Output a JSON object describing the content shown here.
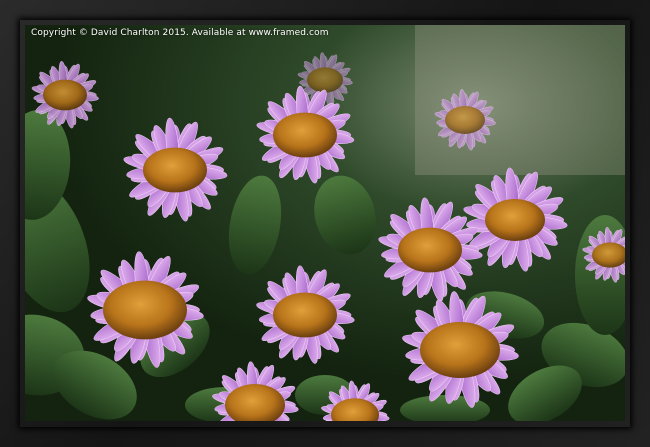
{
  "watermark": {
    "text": "Copyright © David Charlton 2015. Available at www.framed.com"
  },
  "colors": {
    "frame": "#1e1e1e",
    "petal": "#b77ad6",
    "petal_light": "#dca6ee",
    "center": "#c78a1c",
    "foliage": "#2f5a2a"
  }
}
